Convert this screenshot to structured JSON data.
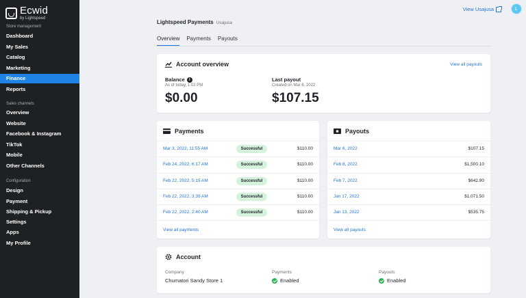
{
  "sidebar": {
    "logo": {
      "name": "Ecwid",
      "sub": "by Lightspeed"
    },
    "sections": {
      "store": "Store management",
      "channels": "Sales channels",
      "config": "Configuration"
    },
    "items": [
      {
        "label": "Dashboard"
      },
      {
        "label": "My Sales"
      },
      {
        "label": "Catalog"
      },
      {
        "label": "Marketing"
      },
      {
        "label": "Finance",
        "active": true
      },
      {
        "label": "Reports"
      },
      {
        "label": "Overview"
      },
      {
        "label": "Website"
      },
      {
        "label": "Facebook & Instagram"
      },
      {
        "label": "TikTok"
      },
      {
        "label": "Mobile"
      },
      {
        "label": "Other Channels"
      },
      {
        "label": "Design"
      },
      {
        "label": "Payment"
      },
      {
        "label": "Shipping & Pickup"
      },
      {
        "label": "Settings"
      },
      {
        "label": "Apps"
      },
      {
        "label": "My Profile"
      }
    ]
  },
  "topbar": {
    "view_store": "View Usajusa",
    "avatar_initial": "L"
  },
  "header": {
    "title": "Lightspeed Payments",
    "subtitle": "Usajusa"
  },
  "tabs": [
    {
      "label": "Overview",
      "active": true
    },
    {
      "label": "Payments"
    },
    {
      "label": "Payouts"
    }
  ],
  "overview": {
    "title": "Account overview",
    "link": "View all payouts",
    "balance": {
      "label": "Balance",
      "sub": "As of today, 1:02 PM",
      "value": "$0.00"
    },
    "last_payout": {
      "label": "Last payout",
      "sub": "Created on Mar 6, 2022",
      "value": "$107.15"
    }
  },
  "payments": {
    "title": "Payments",
    "rows": [
      {
        "date": "Mar 3, 2022, 11:55 AM",
        "status": "Successful",
        "amount": "$110.00"
      },
      {
        "date": "Feb 24, 2022, 6:17 AM",
        "status": "Successful",
        "amount": "$110.00"
      },
      {
        "date": "Feb 22, 2022, 5:15 AM",
        "status": "Successful",
        "amount": "$110.00"
      },
      {
        "date": "Feb 22, 2022, 3:39 AM",
        "status": "Successful",
        "amount": "$110.00"
      },
      {
        "date": "Feb 22, 2022, 2:40 AM",
        "status": "Successful",
        "amount": "$110.00"
      }
    ],
    "view_all": "View all payments"
  },
  "payouts": {
    "title": "Payouts",
    "rows": [
      {
        "date": "Mar 6, 2022",
        "amount": "$107.15"
      },
      {
        "date": "Feb 8, 2022",
        "amount": "$1,500.10"
      },
      {
        "date": "Feb 7, 2022",
        "amount": "$642.90"
      },
      {
        "date": "Jan 17, 2022",
        "amount": "$1,071.50"
      },
      {
        "date": "Jan 13, 2022",
        "amount": "$535.75"
      }
    ],
    "view_all": "View all payouts"
  },
  "account": {
    "title": "Account",
    "company_label": "Company",
    "company_value": "Chumatori Sandy Store 1",
    "payments_label": "Payments",
    "payments_value": "Enabled",
    "payouts_label": "Payouts",
    "payouts_value": "Enabled"
  },
  "colors": {
    "accent": "#1f84e5",
    "link": "#1f74d8",
    "sidebar": "#1e2124",
    "success_bg": "#d4f2dc",
    "success_icon": "#2fb254"
  }
}
